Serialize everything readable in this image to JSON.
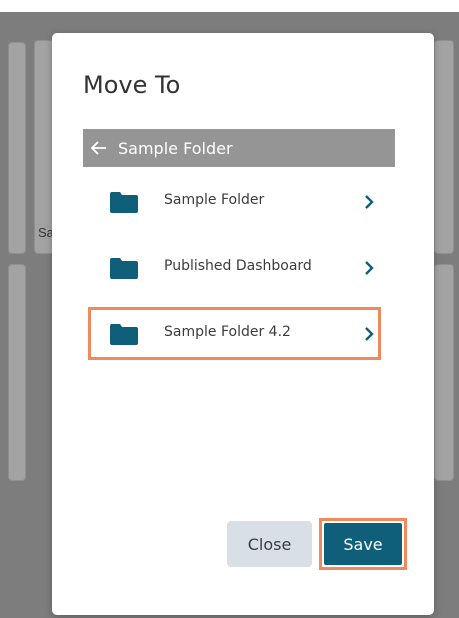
{
  "background": {
    "partial_card_text": "Sa"
  },
  "modal": {
    "title": "Move To",
    "breadcrumb": {
      "icon": "arrow-left-icon",
      "label": "Sample Folder"
    },
    "folders": [
      {
        "label": "Sample Folder",
        "icon": "folder-icon",
        "chevron": "chevron-right-icon"
      },
      {
        "label": "Published Dashboard",
        "icon": "folder-icon",
        "chevron": "chevron-right-icon"
      },
      {
        "label": "Sample Folder 4.2",
        "icon": "folder-icon",
        "chevron": "chevron-right-icon",
        "highlighted": true
      }
    ],
    "buttons": {
      "close_label": "Close",
      "save_label": "Save"
    }
  },
  "colors": {
    "folder_icon": "#0f5f7a",
    "chevron": "#0f5f7a",
    "save_button": "#0f5f7a",
    "close_button": "#d9dfe7",
    "breadcrumb_bg": "#959595",
    "highlight_outline": "#ef8a5e"
  }
}
